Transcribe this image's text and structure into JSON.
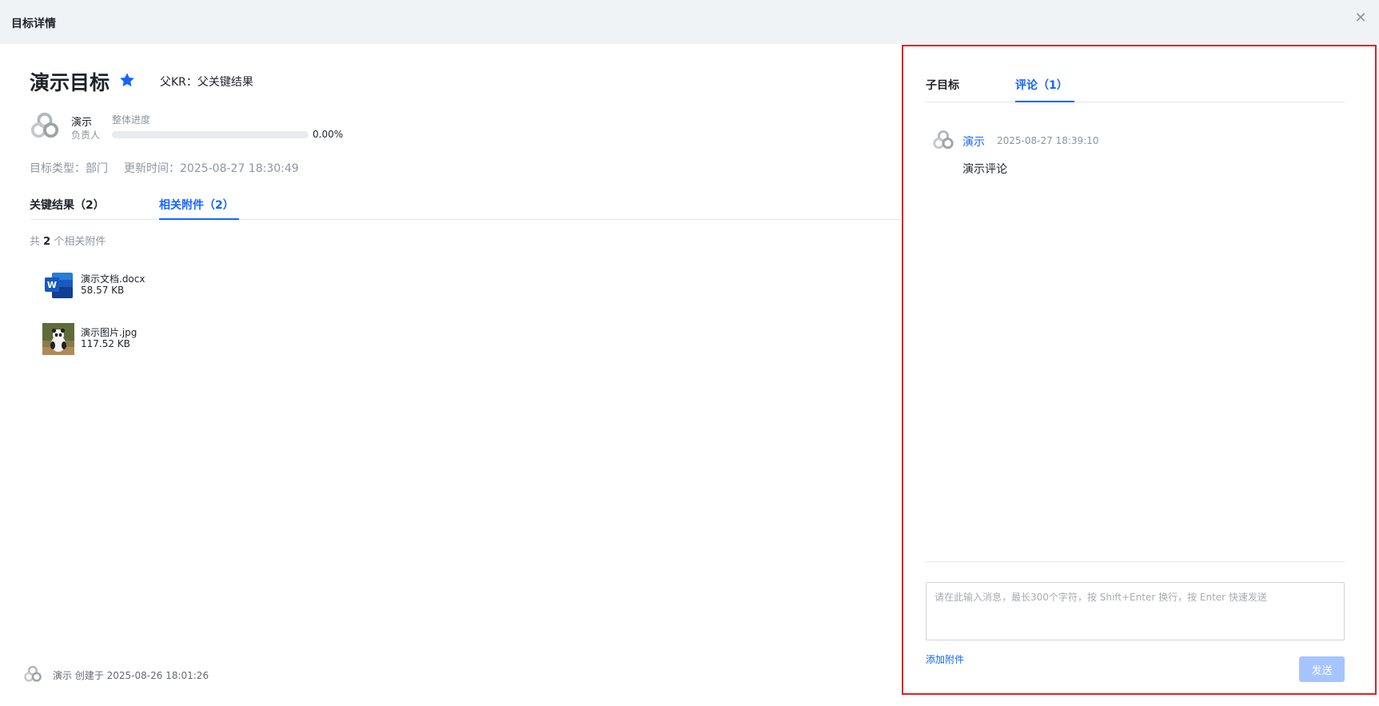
{
  "window": {
    "title": "目标详情",
    "close_icon": "close-icon"
  },
  "goal": {
    "title": "演示目标",
    "starred": true,
    "parent_kr": "父KR：父关键结果",
    "owner": {
      "name": "演示",
      "role": "负责人"
    },
    "progress": {
      "label": "整体进度",
      "value_text": "0.00%",
      "fraction": 0.0
    },
    "type": "目标类型：部门",
    "updated": "更新时间：2025-08-27 18:30:49"
  },
  "tabs": {
    "key_results": "关键结果（2）",
    "attachments": "相关附件（2）"
  },
  "attachments": {
    "count_prefix": "共",
    "count": "2",
    "count_suffix": "个相关附件",
    "items": [
      {
        "name": "演示文档.docx",
        "size": "58.57 KB",
        "icon": "word-file-icon"
      },
      {
        "name": "演示图片.jpg",
        "size": "117.52 KB",
        "icon": "image-thumbnail-icon"
      }
    ]
  },
  "footer": {
    "text": "演示 创建于 2025-08-26 18:01:26"
  },
  "right_panel": {
    "tabs": {
      "sub_goals": "子目标",
      "comments": "评论（1）"
    },
    "comments": [
      {
        "author": "演示",
        "time": "2025-08-27 18:39:10",
        "body": "演示评论"
      }
    ],
    "input": {
      "placeholder": "请在此输入消息，最长300个字符，按 Shift+Enter 换行，按 Enter 快速发送",
      "value": ""
    },
    "add_attachment": "添加附件",
    "send": "发送"
  },
  "colors": {
    "accent": "#1664ff",
    "highlight_border": "#e02020",
    "send_disabled": "#a6c4ff"
  }
}
